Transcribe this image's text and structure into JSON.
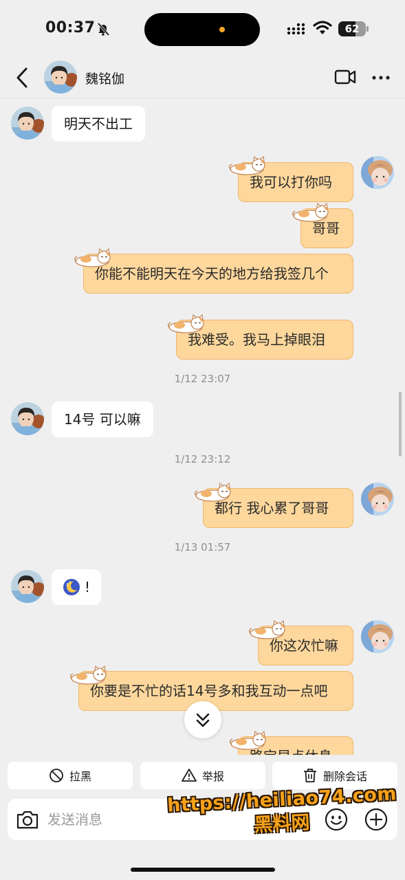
{
  "status_bar": {
    "time": "00:37",
    "battery": "62",
    "battery_fraction": 0.62,
    "icons": [
      "bell-slash-icon",
      "signal-icon",
      "wifi-icon",
      "battery-icon"
    ]
  },
  "header": {
    "contact_name": "魏铭伽",
    "icons": [
      "back-icon",
      "video-call-icon",
      "more-icon"
    ]
  },
  "messages": [
    {
      "dir": "in",
      "text": "明天不出工"
    },
    {
      "dir": "out",
      "text": "我可以打你吗"
    },
    {
      "dir": "out",
      "text": "哥哥"
    },
    {
      "dir": "out",
      "text": "你能不能明天在今天的地方给我签几个"
    },
    {
      "dir": "out",
      "text": "我难受。我马上掉眼泪"
    },
    {
      "type": "timestamp",
      "text": "1/12 23:07"
    },
    {
      "dir": "in",
      "text": "14号 可以嘛"
    },
    {
      "type": "timestamp",
      "text": "1/12 23:12"
    },
    {
      "dir": "out",
      "text": "都行 我心累了哥哥"
    },
    {
      "type": "timestamp",
      "text": "1/13 01:57"
    },
    {
      "dir": "in",
      "text": "!",
      "emoji": "moon-sleep-icon"
    },
    {
      "dir": "out",
      "text": "你这次忙嘛"
    },
    {
      "dir": "out",
      "text": "你要是不忙的话14号多和我互动一点吧"
    },
    {
      "dir": "out",
      "text": "路宝早点休息"
    }
  ],
  "actions": {
    "block": "拉黑",
    "report": "举报",
    "delete_chat": "删除会话"
  },
  "input": {
    "placeholder": "发送消息"
  },
  "watermark": {
    "url": "https://heiliao74.com",
    "name": "黑料网"
  },
  "colors": {
    "background": "#efefef",
    "incoming_bubble": "#ffffff",
    "outgoing_bubble": "#fdd79c",
    "outgoing_border": "#f0b66b",
    "timestamp": "#8f8f8f"
  }
}
